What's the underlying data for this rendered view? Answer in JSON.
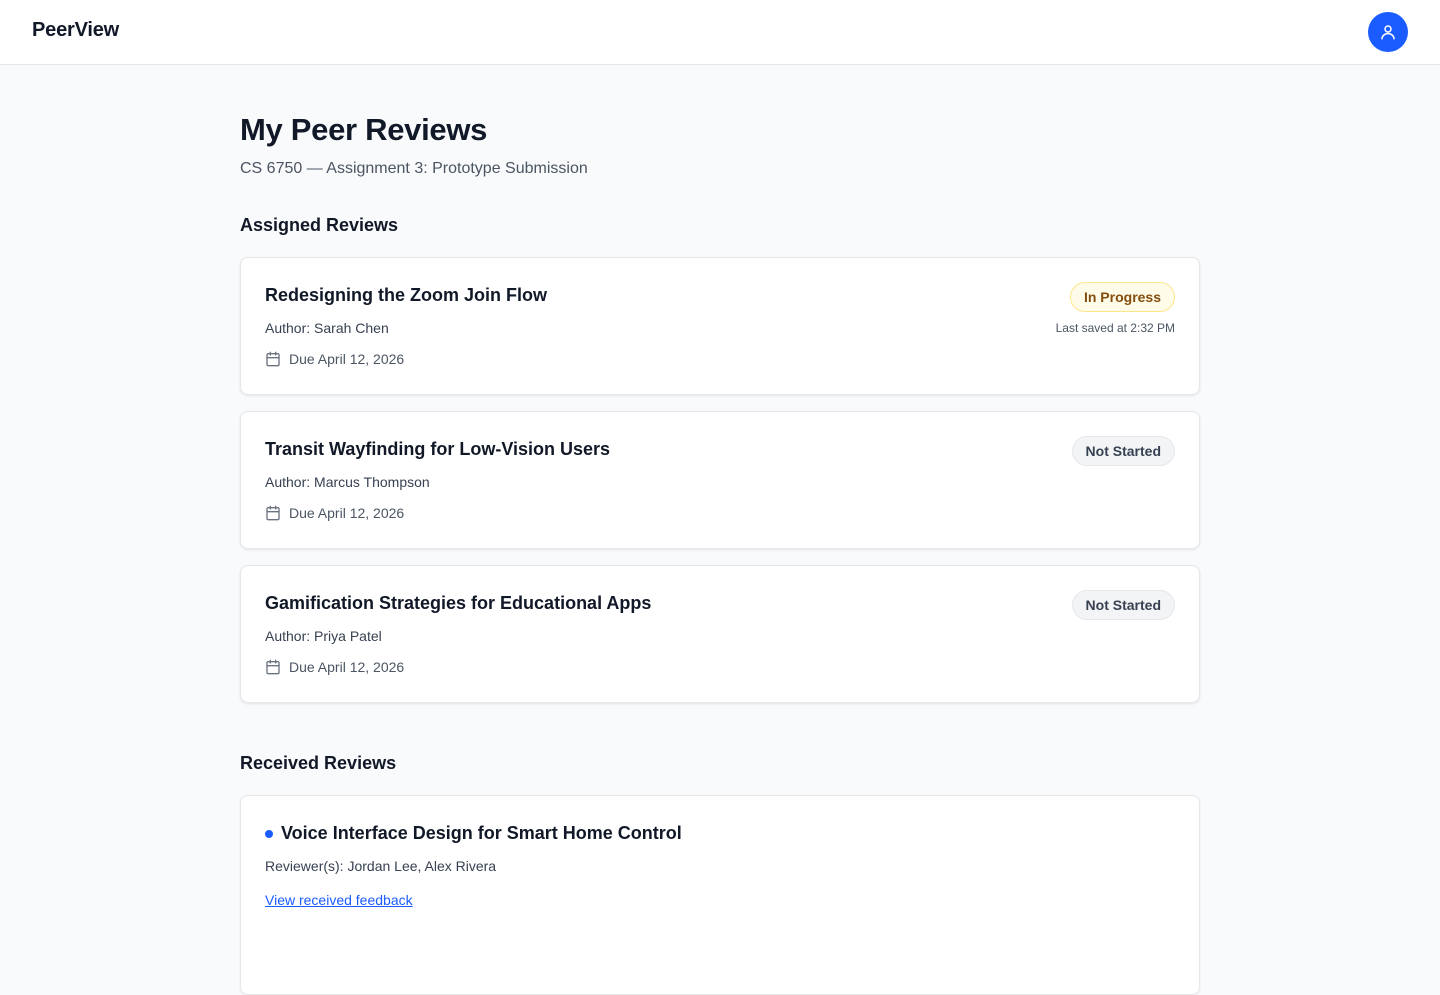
{
  "app": {
    "brand": "PeerView",
    "accent_color": "#1a5cff",
    "avatar_icon": "user-icon"
  },
  "page": {
    "title": "My Peer Reviews",
    "subtitle": "CS 6750 — Assignment 3: Prototype Submission"
  },
  "assigned": {
    "heading": "Assigned Reviews",
    "items": [
      {
        "title": "Redesigning the Zoom Join Flow",
        "author": "Author: Sarah Chen",
        "due": "Due April 12, 2026",
        "status": "In Progress",
        "saved": "Last saved at 2:32 PM"
      },
      {
        "title": "Transit Wayfinding for Low-Vision Users",
        "author": "Author: Marcus Thompson",
        "due": "Due April 12, 2026",
        "status": "Not Started"
      },
      {
        "title": "Gamification Strategies for Educational Apps",
        "author": "Author: Priya Patel",
        "due": "Due April 12, 2026",
        "status": "Not Started"
      }
    ]
  },
  "received": {
    "heading": "Received Reviews",
    "items": [
      {
        "title": "Voice Interface Design for Smart Home Control",
        "reviewers": "Reviewer(s): Jordan Lee, Alex Rivera",
        "link": "View received feedback"
      }
    ]
  }
}
